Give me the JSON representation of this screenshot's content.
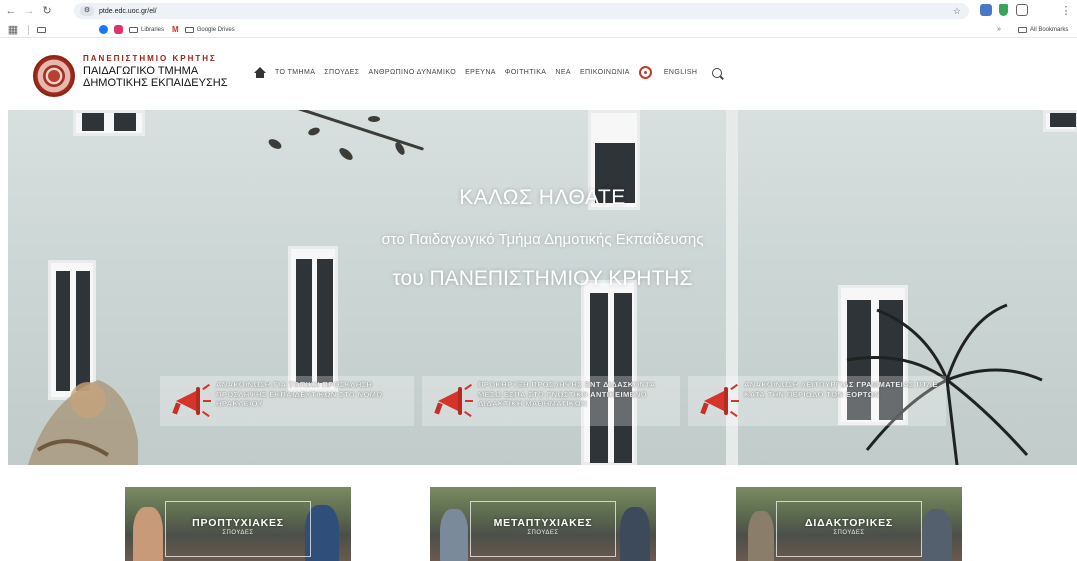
{
  "browser": {
    "url": "ptde.edc.uoc.gr/el/",
    "bookmarks": [
      "Libraries",
      "Google Drives"
    ],
    "bookmarks_right": "All Bookmarks",
    "more_bookmarks": "»"
  },
  "header": {
    "university": "ΠΑΝΕΠΙΣΤΗΜΙΟ ΚΡΗΤΗΣ",
    "dept_line1": "ΠΑΙΔΑΓΩΓΙΚΟ ΤΜΗΜΑ",
    "dept_line2": "ΔΗΜΟΤΙΚΗΣ ΕΚΠΑΙΔΕΥΣΗΣ",
    "nav": [
      "ΤΟ ΤΜΗΜΑ",
      "ΣΠΟΥΔΕΣ",
      "ΑΝΘΡΩΠΙΝΟ ΔΥΝΑΜΙΚΟ",
      "ΕΡΕΥΝΑ",
      "ΦΟΙΤΗΤΙΚΑ",
      "ΝΕΑ",
      "ΕΠΙΚΟΙΝΩΝΙΑ"
    ],
    "language": "ENGLISH"
  },
  "hero": {
    "title": "ΚΑΛΩΣ ΗΛΘΑΤΕ",
    "subtitle": "στο Παιδαγωγικό Τμήμα Δημοτικής Εκπαίδευσης",
    "subtitle2": "του ΠΑΝΕΠΙΣΤΗΜΙΟΥ ΚΡΗΤΗΣ"
  },
  "announcements": [
    "ΑΝΑΚΟΙΝΩΣΗ ΓΙΑ ΤΟΠΙΚΗ ΠΡΟΣΚΛΗΣΗ ΠΡΟΣΛΗΨΗΣ ΕΚΠΑΙΔΕΥΤΙΚΩΝ ΣΤΟ ΝΟΜΟ ΗΡΑΚΛΕΙΟΥ",
    "ΠΡΟΚΗΡΥΞΗ ΠΡΟΣΛΗΨΗΣ ΕΝΤ ΔΙΔΑΣΚΟΝΤΑ ΜΕΣΩ ΕΣΠΑ ΣΤΟ ΓΝΩΣΤΙΚΟ ΑΝΤΙΚΕΙΜΕΝΟ ΔΙΔΑΚΤΙΚΗ ΜΑΘΗΜΑΤΙΚΩΝ",
    "ΑΝΑΚΟΙΝΩΣΗ ΛΕΙΤΟΥΡΓΙΑΣ ΓΡΑΜΜΑΤΕΙΑΣ ΠΤΔΕ ΚΑΤΑ ΤΗΝ ΠΕΡΙΟΔΟ ΤΩΝ ΕΟΡΤΩΝ"
  ],
  "cards": [
    {
      "title": "ΠΡΟΠΤΥΧΙΑΚΕΣ",
      "subtitle": "ΣΠΟΥΔΕΣ"
    },
    {
      "title": "ΜΕΤΑΠΤΥΧΙΑΚΕΣ",
      "subtitle": "ΣΠΟΥΔΕΣ"
    },
    {
      "title": "ΔΙΔΑΚΤΟΡΙΚΕΣ",
      "subtitle": "ΣΠΟΥΔΕΣ"
    }
  ]
}
